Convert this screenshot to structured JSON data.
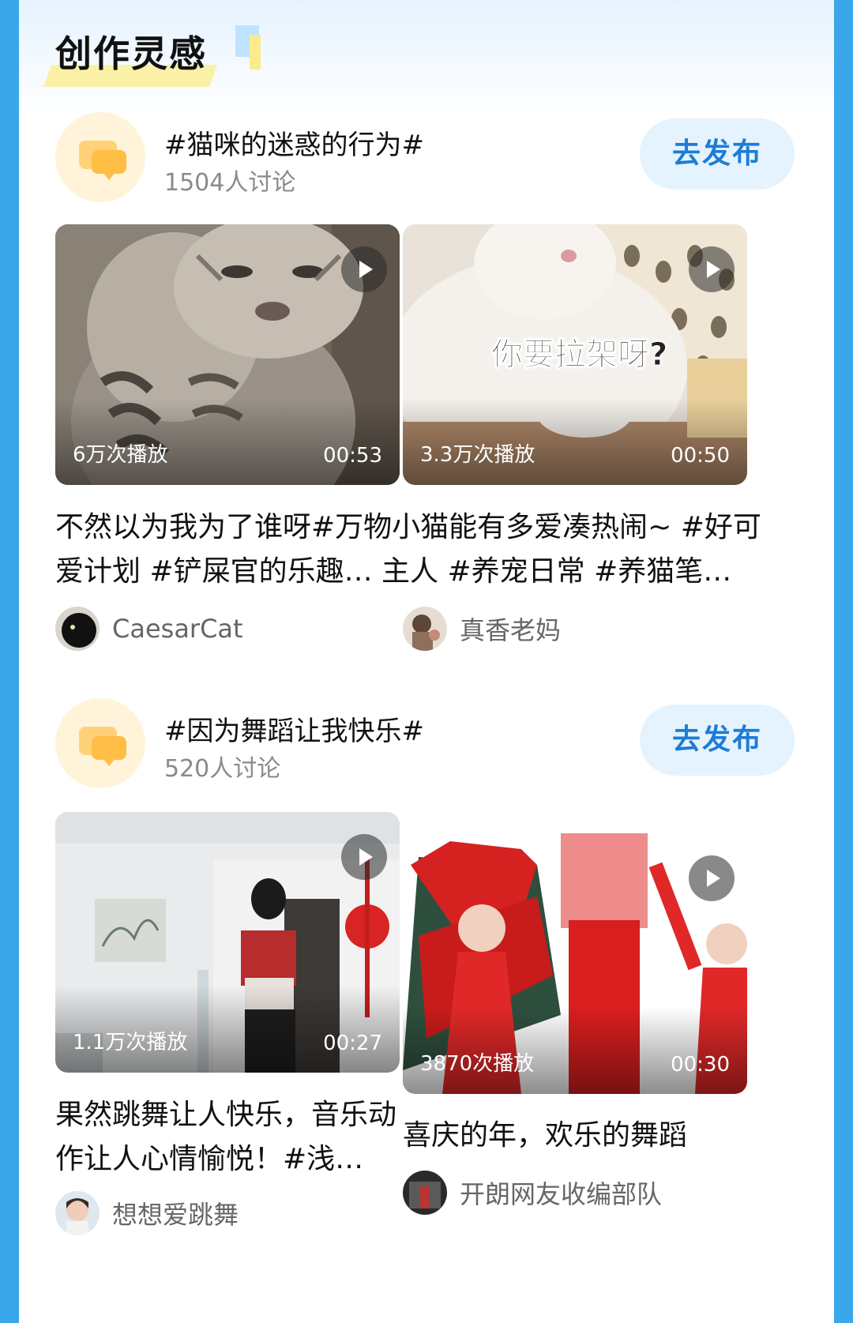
{
  "section": {
    "title": "创作灵感"
  },
  "topics": [
    {
      "name": "#猫咪的迷惑的行为#",
      "count": "1504人讨论",
      "publish_label": "去发布",
      "videos": [
        {
          "views": "6万次播放",
          "duration": "00:53",
          "overlay_text": "",
          "description": "不然以为我为了谁呀#万物小猫能有多爱凑热闹~ #好可爱计划 #铲屎官的乐趣… 主人 #养宠日常 #养猫笔…",
          "author": "CaesarCat"
        },
        {
          "views": "3.3万次播放",
          "duration": "00:50",
          "overlay_text": "你要拉架呀?",
          "description": "",
          "author": "真香老妈"
        }
      ]
    },
    {
      "name": "#因为舞蹈让我快乐#",
      "count": "520人讨论",
      "publish_label": "去发布",
      "videos": [
        {
          "views": "1.1万次播放",
          "duration": "00:27",
          "overlay_text": "",
          "description": "果然跳舞让人快乐，音乐动作让人心情愉悦！#浅…",
          "author": "想想爱跳舞"
        },
        {
          "views": "3870次播放",
          "duration": "00:30",
          "overlay_text": "",
          "description": "喜庆的年，欢乐的舞蹈",
          "author": "开朗网友收编部队"
        }
      ]
    }
  ],
  "icons": [
    "play-icon",
    "chat-bubble-icon"
  ],
  "colors": {
    "page_bg": "#3aa7ea",
    "publish_text": "#1d7cd6",
    "publish_bg": "#e4f3fd"
  }
}
